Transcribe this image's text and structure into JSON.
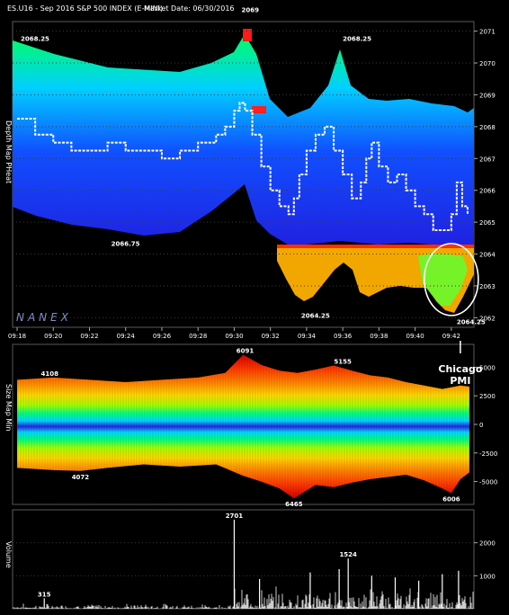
{
  "header": {
    "symbol": "ES.U16 - Sep 2016 S&P 500 INDEX (E-MINI)",
    "market_date_label": "Market Date: 06/30/2016"
  },
  "watermark": "NANEX",
  "chart_data": [
    {
      "type": "heatmap",
      "panel": "depth",
      "ylabel": "Depth Map PHeat",
      "y_ticks": [
        "2071",
        "2070",
        "2069",
        "2068",
        "2067",
        "2066",
        "2065",
        "2064",
        "2063",
        "2062"
      ],
      "ylim": [
        2061.7,
        2071.3
      ],
      "x_ticks": [
        "09:18",
        "09:20",
        "09:22",
        "09:24",
        "09:26",
        "09:28",
        "09:30",
        "09:32",
        "09:34",
        "09:36",
        "09:38",
        "09:40",
        "09:42"
      ],
      "xlim_minutes": [
        557.75,
        583.25
      ],
      "price_line": {
        "x": [
          558,
          559,
          560,
          561,
          562,
          563,
          564,
          565,
          566,
          567,
          568,
          569,
          569.5,
          570,
          570.3,
          570.6,
          571,
          571.5,
          572,
          572.5,
          573,
          573.3,
          573.6,
          574,
          574.5,
          575,
          575.5,
          576,
          576.5,
          577,
          577.3,
          577.6,
          578,
          578.5,
          579,
          579.5,
          580,
          580.5,
          581,
          581.5,
          582,
          582.3,
          582.6,
          582.9
        ],
        "y": [
          2068.25,
          2067.75,
          2067.5,
          2067.25,
          2067.25,
          2067.5,
          2067.25,
          2067.25,
          2067.0,
          2067.25,
          2067.5,
          2067.75,
          2068.0,
          2068.5,
          2068.75,
          2068.5,
          2067.75,
          2066.75,
          2066.0,
          2065.5,
          2065.25,
          2065.75,
          2066.5,
          2067.25,
          2067.75,
          2068.0,
          2067.25,
          2066.5,
          2065.75,
          2066.25,
          2067.0,
          2067.5,
          2066.75,
          2066.25,
          2066.5,
          2066.0,
          2065.5,
          2065.25,
          2064.75,
          2064.75,
          2065.25,
          2066.25,
          2065.5,
          2065.25
        ]
      },
      "annotations": [
        {
          "text": "2068.25",
          "x": 558.2,
          "y": 2070.7
        },
        {
          "text": "2069",
          "x": 570.4,
          "y": 2071.6
        },
        {
          "text": "2068.25",
          "x": 576.0,
          "y": 2070.7
        },
        {
          "text": "2066.75",
          "x": 563.2,
          "y": 2064.25
        },
        {
          "text": "2064.25",
          "x": 573.7,
          "y": 2062.0
        },
        {
          "text": "2064.25",
          "x": 582.3,
          "y": 2061.8
        }
      ],
      "highlight_circle": {
        "cx": 582.0,
        "cy": 2063.2
      }
    },
    {
      "type": "heatmap",
      "panel": "size",
      "ylabel": "Size Map Min",
      "y_ticks": [
        "5000",
        "2500",
        "0",
        "-2500",
        "-5000"
      ],
      "ylim": [
        -7000,
        7000
      ],
      "annotations": [
        {
          "text": "4108",
          "x": 559.8,
          "y": 4100
        },
        {
          "text": "6091",
          "x": 570.6,
          "y": 6100
        },
        {
          "text": "5155",
          "x": 576.0,
          "y": 5150
        },
        {
          "text": "4072",
          "x": 561.5,
          "y": -4100
        },
        {
          "text": "6465",
          "x": 573.3,
          "y": -6465
        },
        {
          "text": "6006",
          "x": 582.0,
          "y": -6006
        }
      ],
      "callout_line1": "Chicago",
      "callout_line2": "PMI",
      "upper_envelope": {
        "x": [
          558,
          560,
          562,
          564,
          566,
          568,
          569.5,
          570.5,
          571.5,
          572.5,
          573.5,
          574.5,
          575.5,
          576.5,
          577.5,
          578.5,
          579.5,
          580.5,
          581.5,
          582.5,
          583
        ],
        "y": [
          3900,
          4100,
          3900,
          3700,
          3900,
          4100,
          4500,
          6091,
          5200,
          4700,
          4500,
          4800,
          5155,
          4700,
          4300,
          4100,
          3700,
          3400,
          3100,
          3400,
          3300
        ]
      },
      "lower_envelope": {
        "x": [
          558,
          560,
          561.5,
          563,
          565,
          567,
          569,
          570.5,
          571.5,
          572.5,
          573.3,
          574.5,
          575.5,
          576.5,
          577.5,
          578.5,
          579.5,
          580.5,
          581.5,
          582,
          582.5,
          583
        ],
        "y": [
          -3800,
          -4000,
          -4072,
          -3800,
          -3500,
          -3700,
          -3500,
          -4500,
          -5000,
          -5600,
          -6465,
          -5300,
          -5500,
          -5100,
          -4800,
          -4600,
          -4400,
          -4900,
          -5600,
          -6006,
          -4800,
          -4200
        ]
      }
    },
    {
      "type": "bar",
      "panel": "volume",
      "ylabel": "Volume",
      "y_ticks": [
        "2000",
        "1000"
      ],
      "ylim": [
        0,
        3000
      ],
      "annotations": [
        {
          "text": "315",
          "x": 559.5,
          "y": 315
        },
        {
          "text": "2701",
          "x": 570.0,
          "y": 2701
        },
        {
          "text": "1524",
          "x": 576.3,
          "y": 1524
        }
      ],
      "peak_bars": {
        "x": [
          559.5,
          570.0,
          576.3,
          571.4,
          574.2,
          575.8,
          577.6,
          578.9,
          580.2,
          581.5,
          582.4
        ],
        "y": [
          315,
          2701,
          1524,
          900,
          1100,
          1200,
          1000,
          950,
          850,
          1050,
          1150
        ]
      }
    }
  ]
}
